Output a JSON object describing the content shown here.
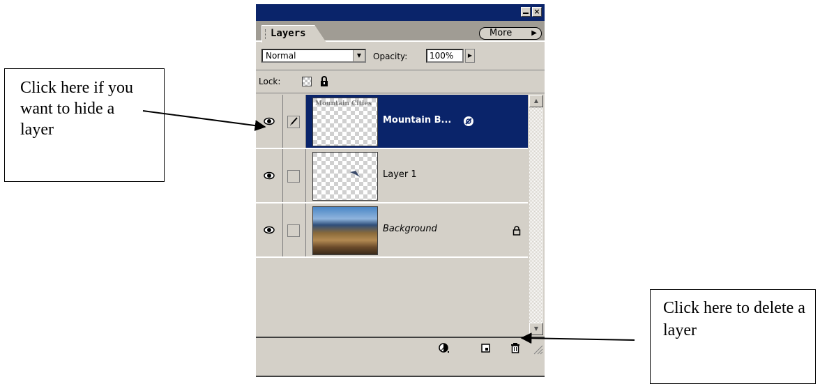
{
  "panel": {
    "tab_label": "Layers",
    "more_label": "More",
    "blend_mode": "Normal",
    "opacity_label": "Opacity:",
    "opacity_value": "100%",
    "lock_label": "Lock:"
  },
  "layers": [
    {
      "name": "Mountain B...",
      "thumb_text": "Mountain Cities",
      "selected": true,
      "visible": true,
      "locked": false
    },
    {
      "name": "Layer 1",
      "selected": false,
      "visible": true,
      "locked": false
    },
    {
      "name": "Background",
      "selected": false,
      "visible": true,
      "locked": true
    }
  ],
  "callouts": {
    "hide_layer": "Click here if you want to hide a layer",
    "delete_layer": "Click here to delete a layer"
  },
  "colors": {
    "selection": "#0a246a",
    "panel_bg": "#d4d0c8"
  }
}
